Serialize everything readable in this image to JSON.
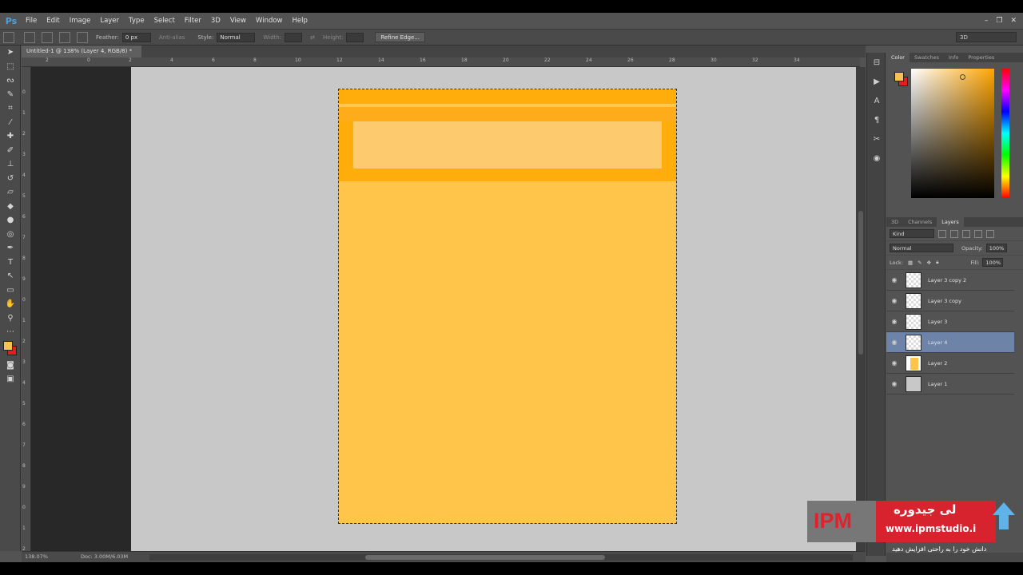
{
  "app": {
    "logo": "Ps",
    "menu": [
      "File",
      "Edit",
      "Image",
      "Layer",
      "Type",
      "Select",
      "Filter",
      "3D",
      "View",
      "Window",
      "Help"
    ],
    "window_controls": [
      "–",
      "❐",
      "✕"
    ]
  },
  "options": {
    "feather_label": "Feather:",
    "feather_value": "0 px",
    "antialias_label": "Anti-alias",
    "style_label": "Style:",
    "style_value": "Normal",
    "width_label": "Width:",
    "height_label": "Height:",
    "refine_button": "Refine Edge...",
    "workspace_value": "3D"
  },
  "document": {
    "tab_title": "Untitled-1 @ 138% (Layer 4, RGB/8) *",
    "tab_close": "×",
    "zoom": "138.07%",
    "doc_size": "Doc: 3.00M/6.03M"
  },
  "rulers": {
    "h_ticks": [
      "2",
      "0",
      "2",
      "4",
      "6",
      "8",
      "10",
      "12",
      "14",
      "16",
      "18",
      "20",
      "22",
      "24",
      "26",
      "28",
      "30",
      "32",
      "34"
    ],
    "v_ticks": [
      "0",
      "1",
      "2",
      "3",
      "4",
      "5",
      "6",
      "7",
      "8",
      "9",
      "0",
      "1",
      "2",
      "3",
      "4",
      "5",
      "6",
      "7",
      "8",
      "9",
      "0",
      "1",
      "2"
    ]
  },
  "panels": {
    "top_tabs": [
      "Color",
      "Swatches",
      "Info",
      "Properties"
    ],
    "bottom_tabs": [
      "3D",
      "Channels",
      "Layers"
    ],
    "layers_filter": "Kind",
    "blend_mode": "Normal",
    "opacity_label": "Opacity:",
    "opacity_value": "100%",
    "lock_label": "Lock:",
    "fill_label": "Fill:",
    "fill_value": "100%",
    "layers": [
      {
        "name": "Layer 3 copy 2",
        "thumb": "transparent",
        "selected": false
      },
      {
        "name": "Layer 3 copy",
        "thumb": "transparent",
        "selected": false
      },
      {
        "name": "Layer 3",
        "thumb": "transparent",
        "selected": false
      },
      {
        "name": "Layer 4",
        "thumb": "transparent",
        "selected": true
      },
      {
        "name": "Layer 2",
        "thumb": "orange",
        "selected": false
      },
      {
        "name": "Layer 1",
        "thumb": "grey",
        "selected": false
      }
    ]
  },
  "colors": {
    "foreground": "#f8c152",
    "background": "#e01f1f",
    "doc_fill": "#ffc44a",
    "doc_header": "#ffad0a",
    "selected_layer": "#6d84a8"
  },
  "watermark": {
    "logo": "IPM",
    "farsi_title": "لی جیدوره",
    "url": "www.ipmstudio.i",
    "tagline": "دانش خود را به راحتی افزایش دهید"
  }
}
